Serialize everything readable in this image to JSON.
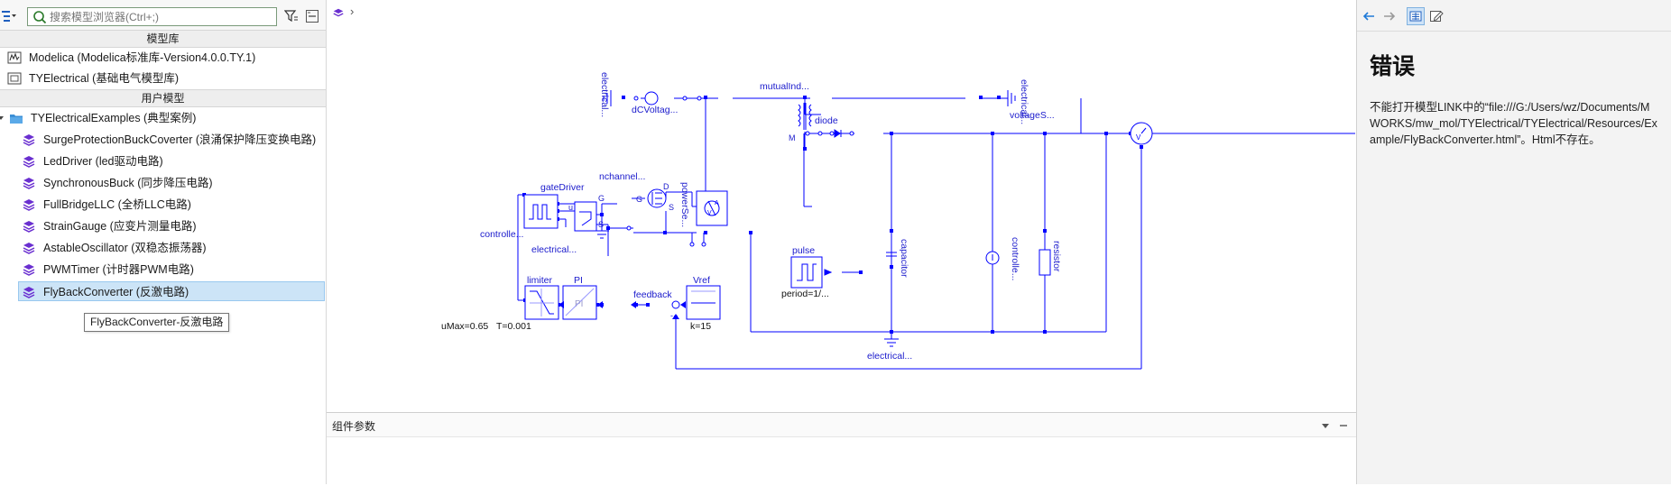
{
  "left_panel": {
    "search_placeholder": "搜索模型浏览器(Ctrl+;)",
    "section_library": "模型库",
    "section_user": "用户模型",
    "library_items": [
      {
        "label": "Modelica (Modelica标准库-Version4.0.0.TY.1)"
      },
      {
        "label": "TYElectrical (基础电气模型库)"
      }
    ],
    "user_root": "TYElectricalExamples (典型案例)",
    "user_items": [
      {
        "label": "SurgeProtectionBuckCoverter (浪涌保护降压变换电路)"
      },
      {
        "label": "LedDriver (led驱动电路)"
      },
      {
        "label": "SynchronousBuck (同步降压电路)"
      },
      {
        "label": "FullBridgeLLC (全桥LLC电路)"
      },
      {
        "label": "StrainGauge (应变片测量电路)"
      },
      {
        "label": "AstableOscillator (双稳态振荡器)"
      },
      {
        "label": "PWMTimer (计时器PWM电路)"
      },
      {
        "label": "FlyBackConverter (反激电路)"
      }
    ],
    "tooltip": "FlyBackConverter-反激电路"
  },
  "center": {
    "breadcrumb_arrow": "›",
    "params_title": "组件参数"
  },
  "diagram": {
    "labels": {
      "electrical_left": "electrical...",
      "dcvoltage": "dCVoltag...",
      "mutualind": "mutualInd...",
      "diode": "diode",
      "voltages": "voltageS...",
      "electrical_right": "electrical...",
      "nchannel": "nchannel...",
      "gatedriver": "gateDriver",
      "powerse": "powerSe...",
      "controller_left": "controlle...",
      "electrical_gd": "electrical...",
      "capacitor": "capacitor",
      "pulse": "pulse",
      "pulse_period": "period=1/...",
      "controller_right": "controlle...",
      "resistor": "resistor",
      "limiter": "limiter",
      "limiter_param": "uMax=0.65",
      "pi": "PI",
      "pi_param": "T=0.001",
      "pi_inner": "PI",
      "feedback": "feedback",
      "vref": "Vref",
      "vref_param": "k=15",
      "electrical_bottom": "electrical...",
      "pin_u": "u",
      "pin_G": "G",
      "pin_S": "S",
      "pin_D": "D",
      "pin_M": "M",
      "pin_minus": "-"
    }
  },
  "right_panel": {
    "title": "错误",
    "body": "不能打开模型LINK中的“file:///G:/Users/wz/Documents/MWORKS/mw_mol/TYElectrical/TYElectrical/Resources/Example/FlyBackConverter.html”。Html不存在。"
  },
  "colors": {
    "wire": "#0000ff",
    "label": "#1a1acc",
    "selection": "#cce4f7",
    "accent_icon": "#1f7ad8"
  }
}
